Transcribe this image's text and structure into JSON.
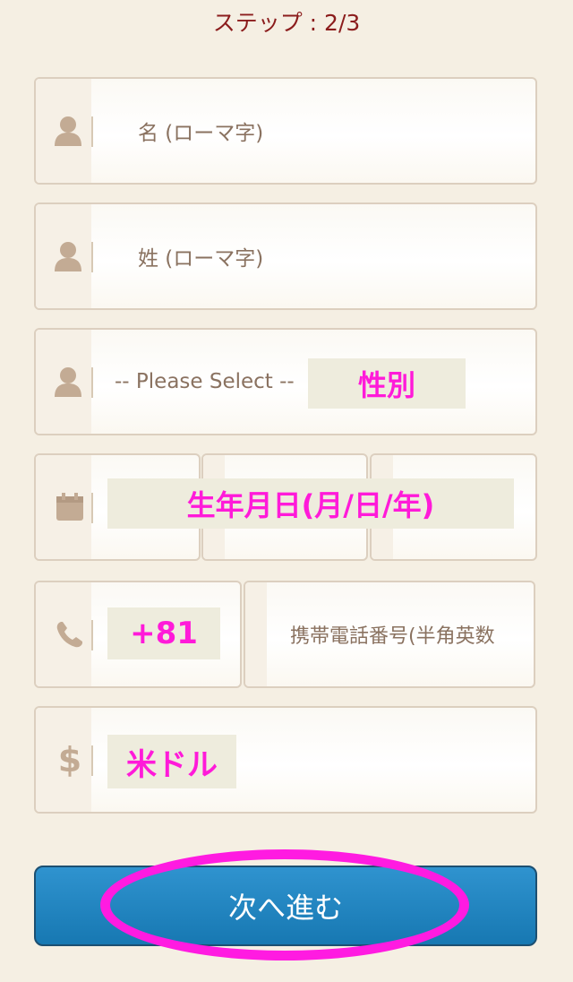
{
  "step": "ステップ : 2/3",
  "first_name": {
    "placeholder": "名 (ローマ字)"
  },
  "last_name": {
    "placeholder": "姓 (ローマ字)"
  },
  "gender": {
    "select_text": "-- Please Select --",
    "highlight": "性別"
  },
  "birthday": {
    "highlight": "生年月日(月/日/年)"
  },
  "phone": {
    "country_code": "+81",
    "placeholder": "携帯電話番号(半角英数"
  },
  "currency": {
    "highlight": "米ドル"
  },
  "next_button": "次へ進む",
  "colors": {
    "accent_magenta": "#ff1ad9",
    "button_blue": "#1f86c2",
    "step_text": "#8b1c1c"
  }
}
